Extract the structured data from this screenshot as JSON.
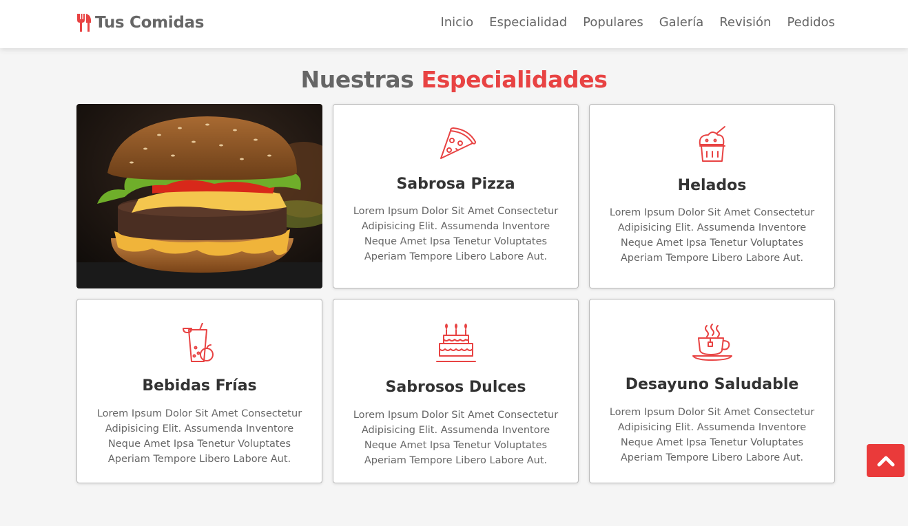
{
  "header": {
    "logo_text": "Tus Comidas",
    "nav": [
      "Inicio",
      "Especialidad",
      "Populares",
      "Galería",
      "Revisión",
      "Pedidos"
    ]
  },
  "section": {
    "title_part1": "Nuestras",
    "title_part2": "Especialidades"
  },
  "cards": [
    {
      "title": "Sabrosa Pizza",
      "icon": "pizza-icon",
      "text": "Lorem Ipsum Dolor Sit Amet Consectetur Adipisicing Elit. Assumenda Inventore Neque Amet Ipsa Tenetur Voluptates Aperiam Tempore Libero Labore Aut."
    },
    {
      "title": "Helados",
      "icon": "ice-cream-icon",
      "text": "Lorem Ipsum Dolor Sit Amet Consectetur Adipisicing Elit. Assumenda Inventore Neque Amet Ipsa Tenetur Voluptates Aperiam Tempore Libero Labore Aut."
    },
    {
      "title": "Bebidas Frías",
      "icon": "cold-drink-icon",
      "text": "Lorem Ipsum Dolor Sit Amet Consectetur Adipisicing Elit. Assumenda Inventore Neque Amet Ipsa Tenetur Voluptates Aperiam Tempore Libero Labore Aut."
    },
    {
      "title": "Sabrosos Dulces",
      "icon": "cake-icon",
      "text": "Lorem Ipsum Dolor Sit Amet Consectetur Adipisicing Elit. Assumenda Inventore Neque Amet Ipsa Tenetur Voluptates Aperiam Tempore Libero Labore Aut."
    },
    {
      "title": "Desayuno Saludable",
      "icon": "coffee-cup-icon",
      "text": "Lorem Ipsum Dolor Sit Amet Consectetur Adipisicing Elit. Assumenda Inventore Neque Amet Ipsa Tenetur Voluptates Aperiam Tempore Libero Labore Aut."
    }
  ],
  "colors": {
    "accent": "#e84343",
    "text": "#333333",
    "muted": "#666666",
    "background": "#f5f5f5"
  },
  "scroll_top_icon": "chevron-up-icon"
}
